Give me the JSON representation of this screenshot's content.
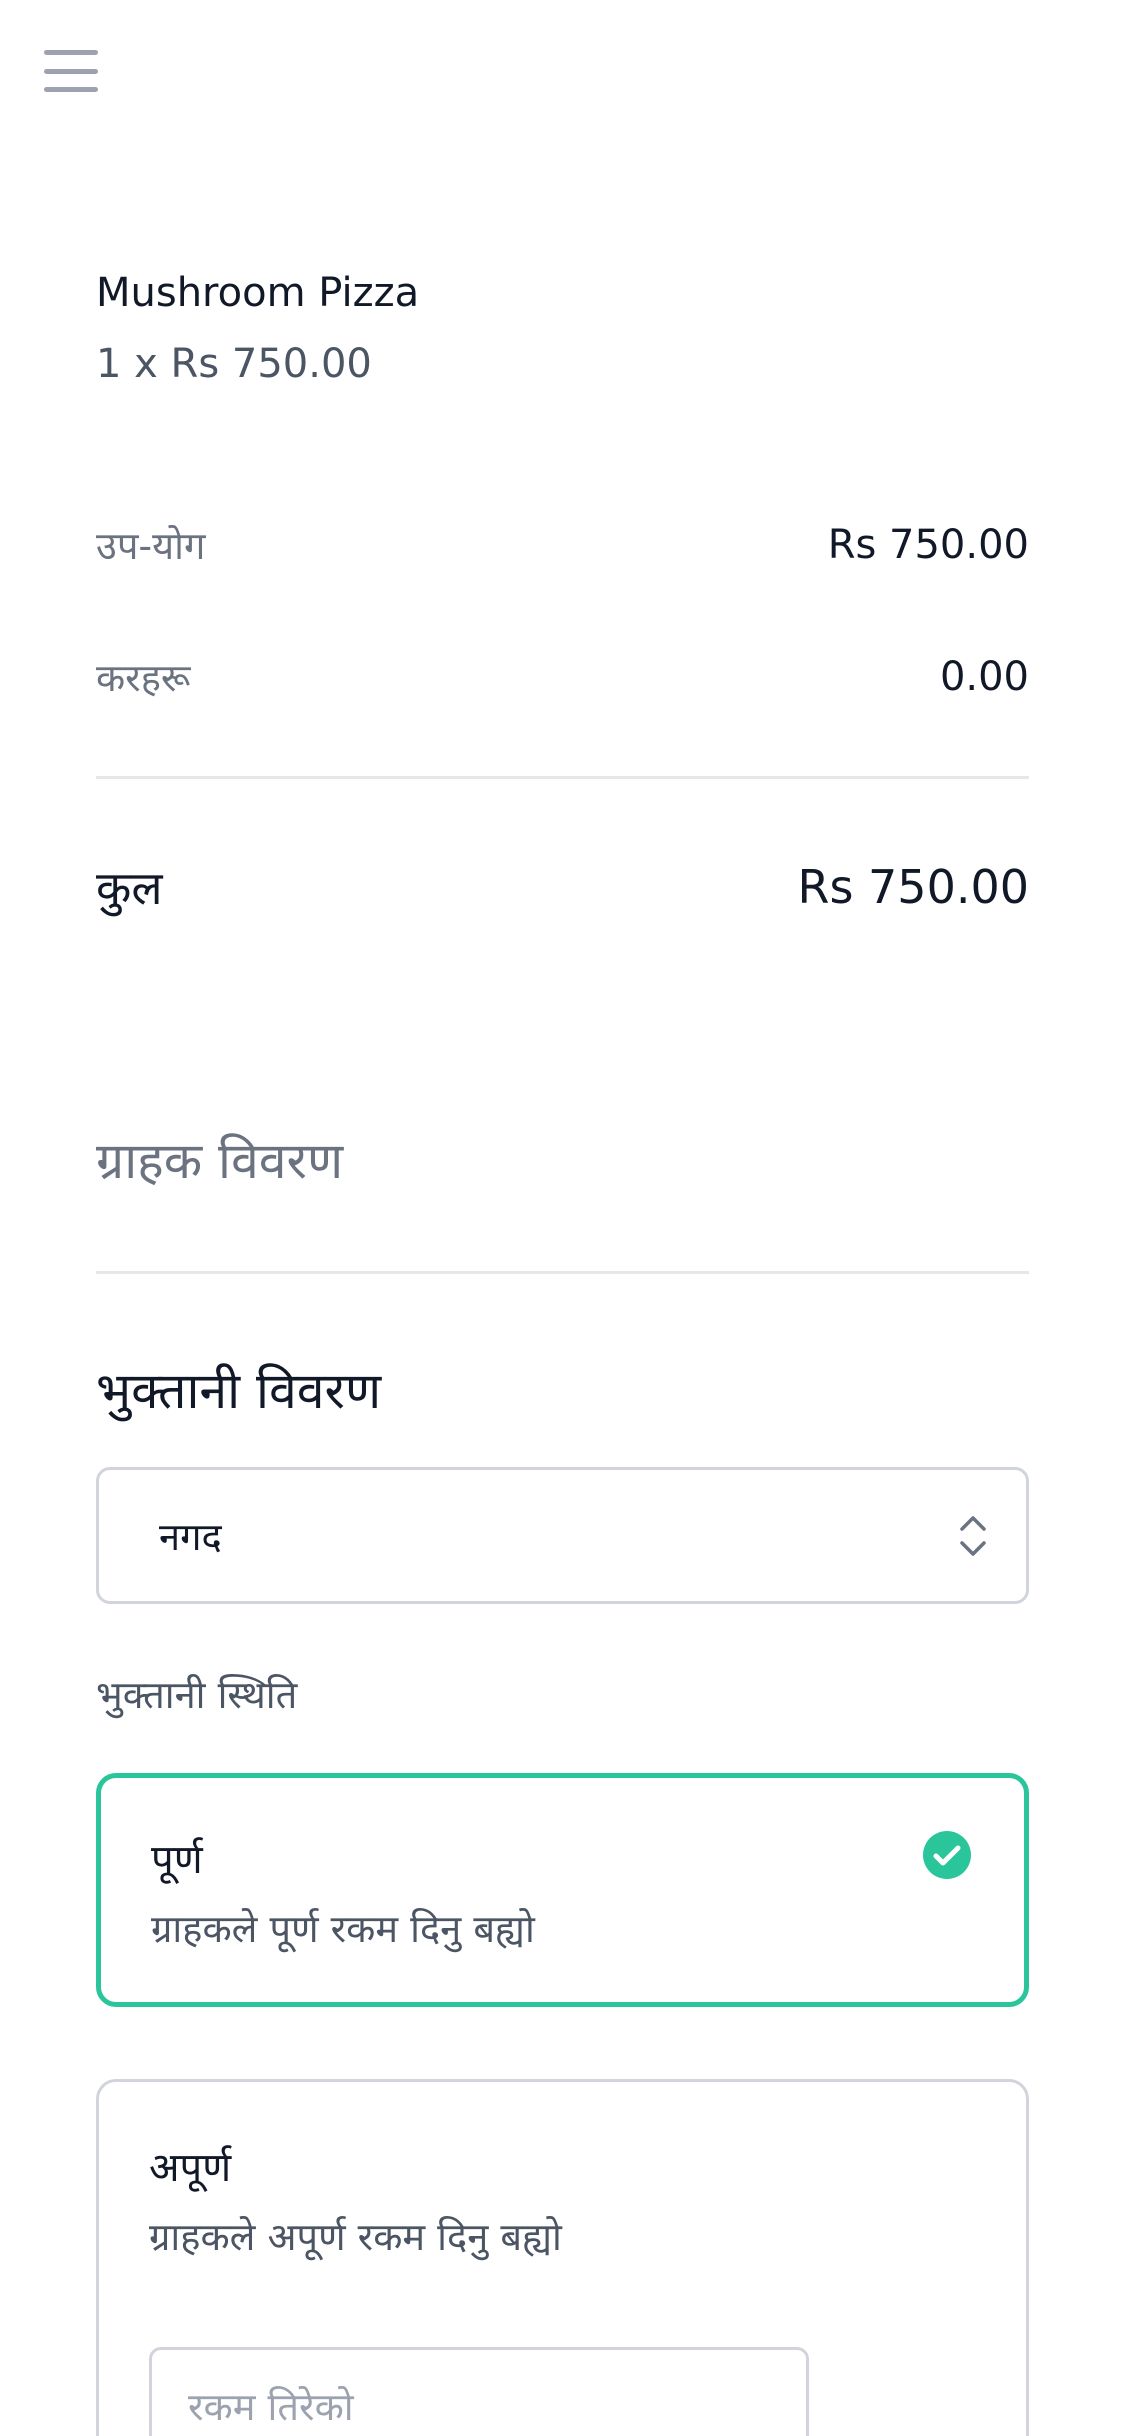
{
  "header": {
    "menu_icon": "hamburger-menu-icon"
  },
  "order": {
    "items": [
      {
        "name": "Mushroom Pizza",
        "quantity_price": "1 x Rs 750.00"
      }
    ],
    "subtotal": {
      "label": "उप-योग",
      "value": "Rs 750.00"
    },
    "taxes": {
      "label": "करहरू",
      "value": "0.00"
    },
    "total": {
      "label": "कुल",
      "value": "Rs 750.00"
    }
  },
  "customer_details": {
    "heading": "ग्राहक विवरण"
  },
  "payment": {
    "heading": "भुक्तानी विवरण",
    "method": {
      "selected": "नगद"
    },
    "status_label": "भुक्तानी स्थिति",
    "options": [
      {
        "title": "पूर्ण",
        "description": "ग्राहकले पूर्ण रकम दिनु बह्यो",
        "selected": true
      },
      {
        "title": "अपूर्ण",
        "description": "ग्राहकले अपूर्ण रकम दिनु बह्यो",
        "selected": false
      }
    ],
    "amount_input": {
      "placeholder": "रकम तिरेको",
      "value": ""
    }
  },
  "colors": {
    "accent": "#2bc59b",
    "border": "#d1d5db",
    "text_primary": "#111827",
    "text_muted": "#6b7280"
  }
}
